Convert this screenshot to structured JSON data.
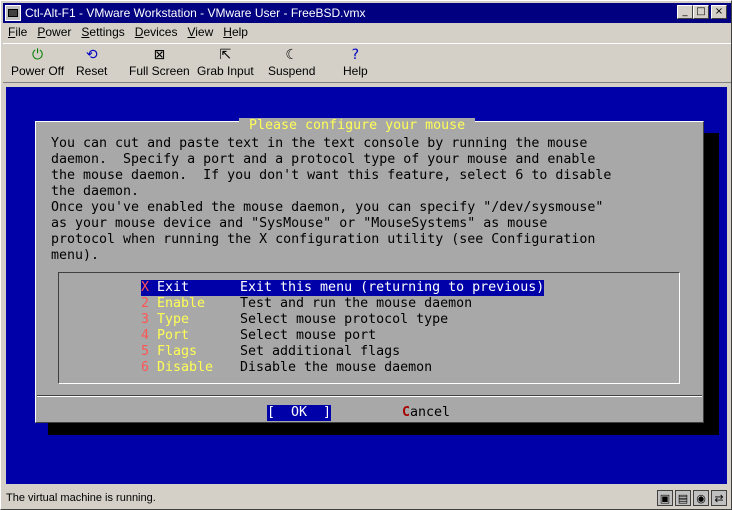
{
  "window": {
    "title": "Ctl-Alt-F1 - VMware Workstation - VMware User - FreeBSD.vmx",
    "minimize_glyph": "_",
    "maximize_glyph": "□",
    "close_glyph": "×"
  },
  "menubar": {
    "items": [
      {
        "label": "File",
        "hotkey": "F",
        "rest": "ile"
      },
      {
        "label": "Power",
        "hotkey": "P",
        "rest": "ower"
      },
      {
        "label": "Settings",
        "hotkey": "S",
        "rest": "ettings"
      },
      {
        "label": "Devices",
        "hotkey": "D",
        "rest": "evices"
      },
      {
        "label": "View",
        "hotkey": "V",
        "rest": "iew"
      },
      {
        "label": "Help",
        "hotkey": "H",
        "rest": "elp"
      }
    ]
  },
  "toolbar": {
    "buttons": [
      {
        "label": "Power Off",
        "icon": "power-icon",
        "glyph": "⏻",
        "color": "#008000"
      },
      {
        "label": "Reset",
        "icon": "reset-icon",
        "glyph": "⟲",
        "color": "#0000c0"
      },
      {
        "label": "Full Screen",
        "icon": "fullscreen-icon",
        "glyph": "⊠",
        "color": "#000000"
      },
      {
        "label": "Grab Input",
        "icon": "cursor-icon",
        "glyph": "⇱",
        "color": "#000000"
      },
      {
        "label": "Suspend",
        "icon": "moon-icon",
        "glyph": "☾",
        "color": "#000000"
      },
      {
        "label": "Help",
        "icon": "help-icon",
        "glyph": "?",
        "color": "#0000c0"
      }
    ]
  },
  "dialog": {
    "title": " Please configure your mouse ",
    "text_lines": [
      "You can cut and paste text in the text console by running the mouse",
      "daemon.  Specify a port and a protocol type of your mouse and enable",
      "the mouse daemon.  If you don't want this feature, select 6 to disable",
      "the daemon.",
      "Once you've enabled the mouse daemon, you can specify \"/dev/sysmouse\"",
      "as your mouse device and \"SysMouse\" or \"MouseSystems\" as mouse",
      "protocol when running the X configuration utility (see Configuration",
      "menu)."
    ],
    "menu_items": [
      {
        "num": "X",
        "name": "Exit",
        "desc": "Exit this menu (returning to previous)",
        "selected": true
      },
      {
        "num": "2",
        "name": "Enable",
        "desc": "Test and run the mouse daemon",
        "selected": false
      },
      {
        "num": "3",
        "name": "Type",
        "desc": "Select mouse protocol type",
        "selected": false
      },
      {
        "num": "4",
        "name": "Port",
        "desc": "Select mouse port",
        "selected": false
      },
      {
        "num": "5",
        "name": "Flags",
        "desc": "Set additional flags",
        "selected": false
      },
      {
        "num": "6",
        "name": "Disable",
        "desc": "Disable the mouse daemon",
        "selected": false
      }
    ],
    "ok_label": "[  OK  ]",
    "cancel_hot": "C",
    "cancel_rest": "ancel"
  },
  "status": {
    "message": "The virtual machine is running.",
    "devices": [
      {
        "icon": "floppy-icon",
        "glyph": "▣"
      },
      {
        "icon": "harddisk-icon",
        "glyph": "▤"
      },
      {
        "icon": "cdrom-icon",
        "glyph": "◉"
      },
      {
        "icon": "network-icon",
        "glyph": "⇄"
      }
    ]
  },
  "colors": {
    "titlebar": "#000080",
    "console_bg": "#0000a8",
    "dialog_bg": "#a8a8a8",
    "title_yellow": "#ffff55",
    "hotkey_red": "#ff5555"
  }
}
